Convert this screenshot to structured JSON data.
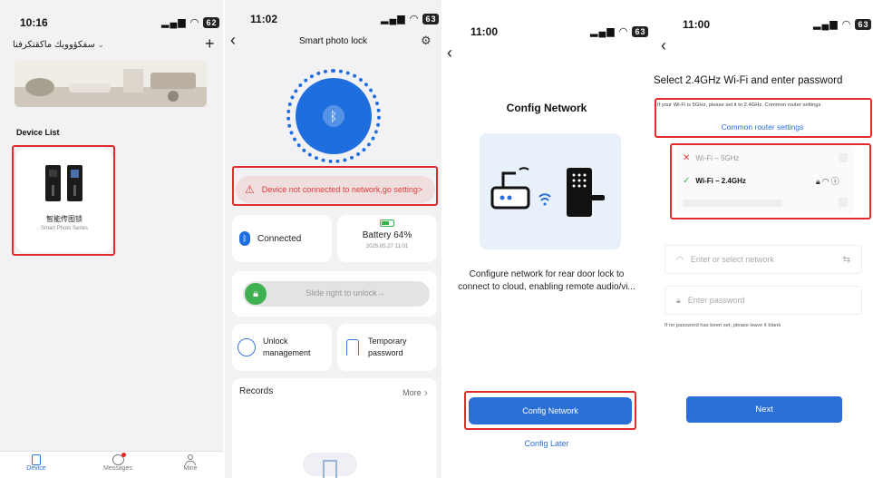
{
  "screen1": {
    "time": "10:16",
    "battery": "62",
    "account": "سفكۆووبك ماكقتكرفنا",
    "section_title": "Device List",
    "device_name": "智能传图锁",
    "device_series": "Smart Photo Series",
    "tabs": [
      {
        "label": "Device",
        "icon": "device-icon",
        "active": true
      },
      {
        "label": "Messages",
        "icon": "chat-icon",
        "active": false
      },
      {
        "label": "Mine",
        "icon": "person-icon",
        "active": false
      }
    ],
    "accent": "#2a6fd6"
  },
  "screen2": {
    "time": "11:02",
    "battery": "63",
    "title": "Smart photo lock",
    "warning": "Device not connected to network,go setting>",
    "connected": "Connected",
    "battery_label": "Battery 64%",
    "battery_date": "2025.05.27 11:01",
    "slide_text": "Slide right to unlock→",
    "unlock_line1": "Unlock",
    "unlock_line2": "management",
    "temp_line1": "Temporary",
    "temp_line2": "password",
    "records": "Records",
    "more": "More",
    "accent": "#1e6ee0",
    "warn_color": "#e23a3a"
  },
  "screen3": {
    "time": "11:00",
    "battery": "63",
    "title": "Config Network",
    "description": "Configure network for rear door lock to connect to cloud, enabling remote audio/vi...",
    "button": "Config Network",
    "later": "Config Later"
  },
  "screen4": {
    "time": "11:00",
    "battery": "63",
    "heading": "Select 2.4GHz Wi-Fi and enter password",
    "note": "If your Wi-Fi is 5GHz, please set it to 2.4GHz. Common router settings",
    "router_link": "Common router settings",
    "wifi_bad": "Wi-Fi – 5GHz",
    "wifi_good": "Wi-Fi – 2.4GHz",
    "ssid_placeholder": "Enter or select network",
    "pwd_placeholder": "Enter password",
    "hint": "If no password has been set, please leave it blank",
    "next": "Next"
  }
}
